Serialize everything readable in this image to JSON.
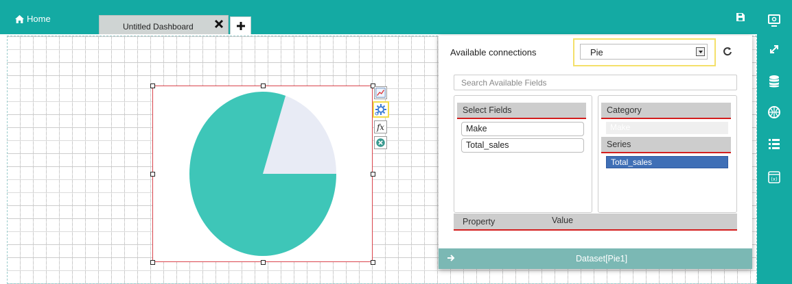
{
  "header": {
    "home_label": "Home",
    "tab_label": "Untitled Dashboard",
    "add_tab_icon": "plus-icon",
    "save_icon": "save-icon"
  },
  "sidebar": {
    "icons": [
      "monitor-icon",
      "expand-icon",
      "database-icon",
      "globe-icon",
      "list-icon",
      "function-icon"
    ]
  },
  "widget": {
    "type": "pie",
    "tools": [
      "chart-settings-icon",
      "gear-icon",
      "fx-icon",
      "close-icon"
    ]
  },
  "chart_data": {
    "type": "pie",
    "slices": [
      {
        "fraction": 0.8,
        "color": "#3ec6b8"
      },
      {
        "fraction": 0.2,
        "color": "#e8ebf5"
      }
    ]
  },
  "panel": {
    "available_connections_label": "Available connections",
    "connection_value": "Pie",
    "search_placeholder": "Search Available Fields",
    "select_fields_header": "Select Fields",
    "fields": [
      "Make",
      "Total_sales"
    ],
    "category_header": "Category",
    "category_value": "Make",
    "series_header": "Series",
    "series_value": "Total_sales",
    "property_header": "Property",
    "value_header": "Value",
    "footer_label": "Dataset[Pie1]"
  },
  "colors": {
    "teal": "#14aaa3",
    "selection_border": "#d9434b",
    "highlight": "#f4e06a",
    "series_blue": "#3f6fb6"
  }
}
